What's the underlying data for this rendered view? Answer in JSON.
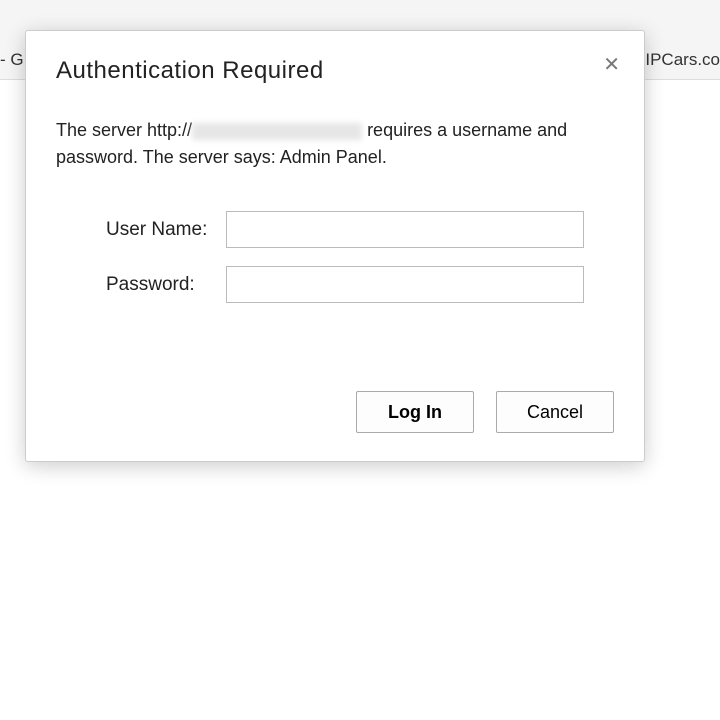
{
  "toolbar": {
    "left_fragment": "- G",
    "right_fragment": "IPCars.co"
  },
  "dialog": {
    "title": "Authentication Required",
    "message_prefix": "The server http://",
    "message_suffix": " requires a username and password. The server says: Admin Panel.",
    "username_label": "User Name:",
    "password_label": "Password:",
    "login_label": "Log In",
    "cancel_label": "Cancel",
    "close_symbol": "✕"
  }
}
